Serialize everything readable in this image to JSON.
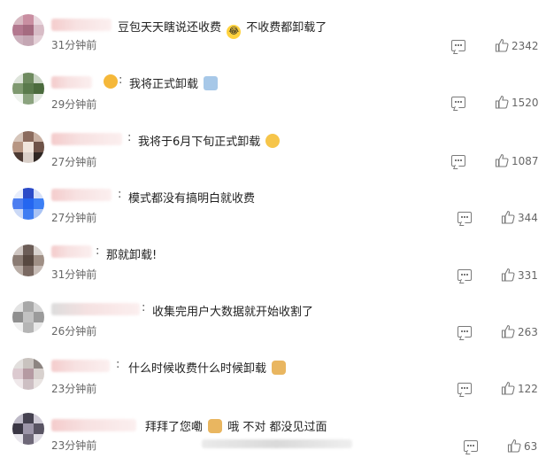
{
  "comments": [
    {
      "text": "豆包天天瞎说还收费",
      "text2": "不收费都卸载了",
      "emoji": "😂",
      "time": "31分钟前",
      "likes": "2342"
    },
    {
      "text": "我将正式卸载",
      "time": "29分钟前",
      "likes": "1520"
    },
    {
      "text": "我将于6月下旬正式卸载",
      "time": "27分钟前",
      "likes": "1087"
    },
    {
      "text": "模式都没有搞明白就收费",
      "time": "27分钟前",
      "likes": "344"
    },
    {
      "text": "那就卸载!",
      "time": "31分钟前",
      "likes": "331"
    },
    {
      "text": "收集完用户大数据就开始收割了",
      "time": "26分钟前",
      "likes": "263"
    },
    {
      "text": "什么时候收费什么时候卸载",
      "time": "23分钟前",
      "likes": "122"
    },
    {
      "text": "拜拜了您嘞",
      "text2": "哦 不对 都没见过面",
      "time": "23分钟前",
      "likes": "63"
    }
  ],
  "colors": {
    "like_icon": "#7a7a7a",
    "reply_icon": "#7a7a7a",
    "time": "#666666",
    "text": "#222222"
  }
}
